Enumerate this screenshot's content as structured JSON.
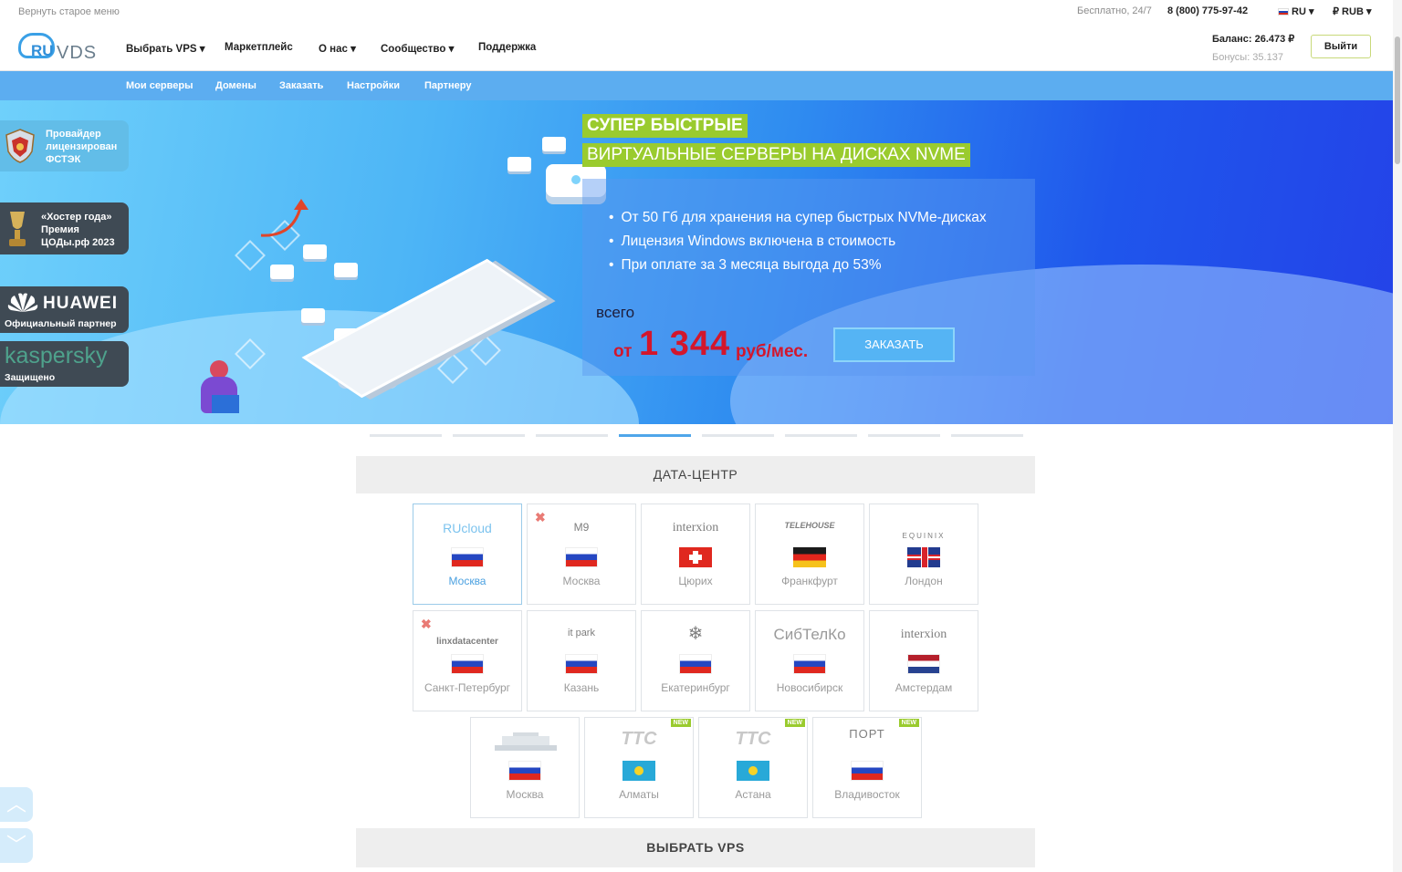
{
  "topbar": {
    "old_menu": "Вернуть старое меню",
    "free": "Бесплатно, 24/7",
    "phone": "8 (800) 775-97-42",
    "language": "RU ▾",
    "currency": "₽ RUB ▾"
  },
  "header": {
    "logo_ru": "RU",
    "logo_vds": "VDS",
    "nav": [
      "Выбрать VPS ▾",
      "Маркетплейс",
      "О нас ▾",
      "Сообщество ▾",
      "Поддержка"
    ],
    "balance": "Баланс: 26.473 ₽",
    "bonus": "Бонусы: 35.137",
    "logout": "Выйти"
  },
  "subnav": [
    "Мои серверы",
    "Домены",
    "Заказать",
    "Настройки",
    "Партнеру"
  ],
  "badges": {
    "fstek": "Провайдер лицензирован ФСТЭК",
    "hoster": "«Хостер года» Премия ЦОДы.рф 2023",
    "huawei_brand": "HUAWEI",
    "huawei": "Официальный партнер",
    "kaspersky_brand": "kaspersky",
    "kaspersky": "Защищено"
  },
  "hero": {
    "tag1": "СУПЕР БЫСТРЫЕ",
    "tag2": "ВИРТУАЛЬНЫЕ СЕРВЕРЫ НА ДИСКАХ NVME",
    "feature1": "От 50 Гб для хранения на супер быстрых NVMe-дисках",
    "feature2": "Лицензия Windows включена в стоимость",
    "feature3": "При оплате за 3 месяца выгода до 53%",
    "total": "всего",
    "from": "от",
    "price": "1 344",
    "per": "руб/мес.",
    "order": "ЗАКАЗАТЬ"
  },
  "slider": {
    "count": 8,
    "active": 3
  },
  "datacenter": {
    "title": "ДАТА-ЦЕНТР",
    "items": [
      {
        "logo": "RUcloud",
        "city": "Москва",
        "selected": true
      },
      {
        "logo": "M9",
        "city": "Москва",
        "unavailable": true
      },
      {
        "logo": "interxion",
        "city": "Цюрих"
      },
      {
        "logo": "TELEHOUSE",
        "city": "Франкфурт"
      },
      {
        "logo": "EQUINIX",
        "city": "Лондон"
      },
      {
        "logo": "linxdatacenter",
        "city": "Санкт-Петербург",
        "unavailable": true
      },
      {
        "logo": "it park",
        "city": "Казань"
      },
      {
        "logo": "❄",
        "city": "Екатеринбург"
      },
      {
        "logo": "СибТелКо",
        "city": "Новосибирск"
      },
      {
        "logo": "interxion",
        "city": "Амстердам"
      },
      {
        "logo": "",
        "city": "Москва"
      },
      {
        "logo": "TTC",
        "city": "Алматы",
        "badge": "NEW"
      },
      {
        "logo": "TTC",
        "city": "Астана",
        "badge": "NEW"
      },
      {
        "logo": "ПОРТ",
        "city": "Владивосток",
        "badge": "NEW"
      }
    ]
  },
  "vps_section": {
    "title": "ВЫБРАТЬ VPS"
  },
  "colors": {
    "accent": "#5cadf0",
    "green": "#9acb2e",
    "price": "#d3162c"
  }
}
